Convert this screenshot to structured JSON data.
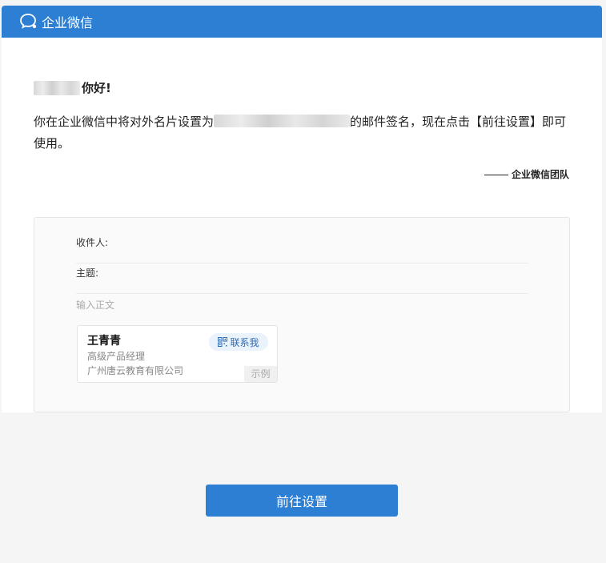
{
  "header": {
    "title": "企业微信",
    "brand_color": "#2d7fd4"
  },
  "greeting": {
    "suffix": "你好!"
  },
  "message": {
    "before": "你在企业微信中将对外名片设置为",
    "after": "的邮件签名，现在点击【前往设置】即可使用。"
  },
  "signature": {
    "text": "企业微信团队"
  },
  "preview": {
    "recipient_label": "收件人:",
    "subject_label": "主题:",
    "body_placeholder": "输入正文",
    "card": {
      "name": "王青青",
      "title": "高级产品经理",
      "company": "广州唐云教育有限公司",
      "contact_label": "联系我",
      "sample_label": "示例"
    }
  },
  "action": {
    "button_label": "前往设置"
  }
}
